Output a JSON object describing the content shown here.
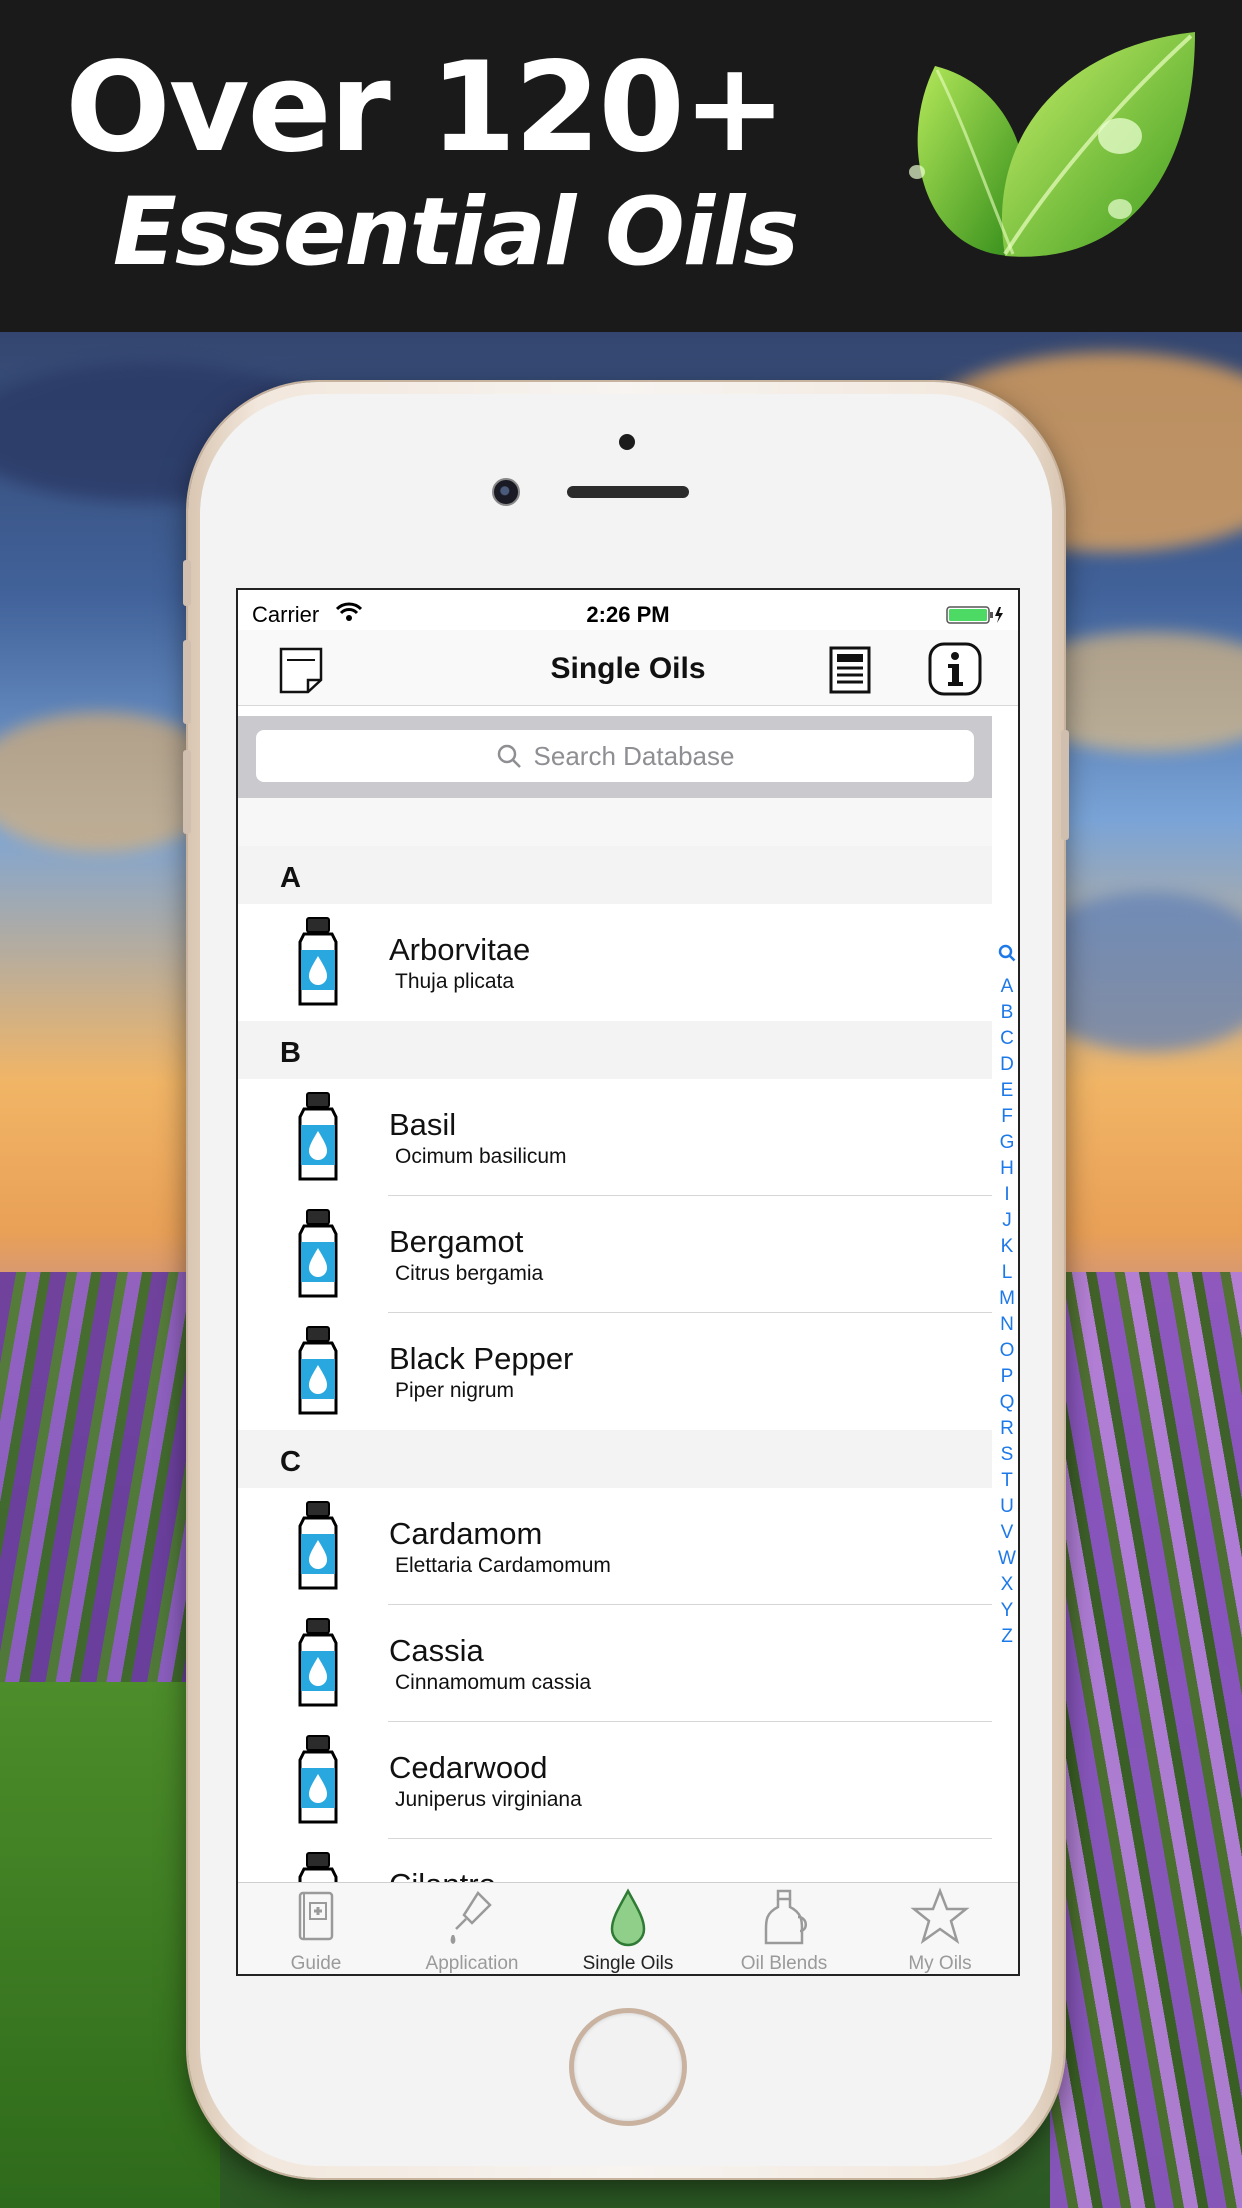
{
  "promo": {
    "headline_line1": "Over 120+",
    "headline_line2": "Essential Oils",
    "leaf_icon": "green-leaves-icon"
  },
  "status_bar": {
    "carrier": "Carrier",
    "time": "2:26 PM",
    "battery_color": "#4cd964"
  },
  "nav": {
    "title": "Single Oils",
    "left_icon": "notes-icon",
    "right_icons": [
      "document-icon",
      "info-icon"
    ]
  },
  "search": {
    "placeholder": "Search Database"
  },
  "sections": [
    {
      "letter": "A",
      "oils": [
        {
          "name": "Arborvitae",
          "latin": "Thuja plicata"
        }
      ]
    },
    {
      "letter": "B",
      "oils": [
        {
          "name": "Basil",
          "latin": "Ocimum basilicum"
        },
        {
          "name": "Bergamot",
          "latin": "Citrus bergamia"
        },
        {
          "name": "Black Pepper",
          "latin": "Piper nigrum"
        }
      ]
    },
    {
      "letter": "C",
      "oils": [
        {
          "name": "Cardamom",
          "latin": "Elettaria Cardamomum"
        },
        {
          "name": "Cassia",
          "latin": "Cinnamomum cassia"
        },
        {
          "name": "Cedarwood",
          "latin": "Juniperus virginiana"
        },
        {
          "name": "Cilantro",
          "latin": ""
        }
      ]
    }
  ],
  "index_letters": [
    "A",
    "B",
    "C",
    "D",
    "E",
    "F",
    "G",
    "H",
    "I",
    "J",
    "K",
    "L",
    "M",
    "N",
    "O",
    "P",
    "Q",
    "R",
    "S",
    "T",
    "U",
    "V",
    "W",
    "X",
    "Y",
    "Z"
  ],
  "tabs": [
    {
      "label": "Guide",
      "icon": "guide-book-icon",
      "active": false
    },
    {
      "label": "Application",
      "icon": "dropper-icon",
      "active": false
    },
    {
      "label": "Single Oils",
      "icon": "oil-drop-icon",
      "active": true
    },
    {
      "label": "Oil Blends",
      "icon": "oil-bottle-icon",
      "active": false
    },
    {
      "label": "My Oils",
      "icon": "star-icon",
      "active": false
    }
  ],
  "colors": {
    "accent_blue": "#1e79e8",
    "bottle_blue": "#29a8e0",
    "active_tab_green": "#8fcf8a"
  }
}
